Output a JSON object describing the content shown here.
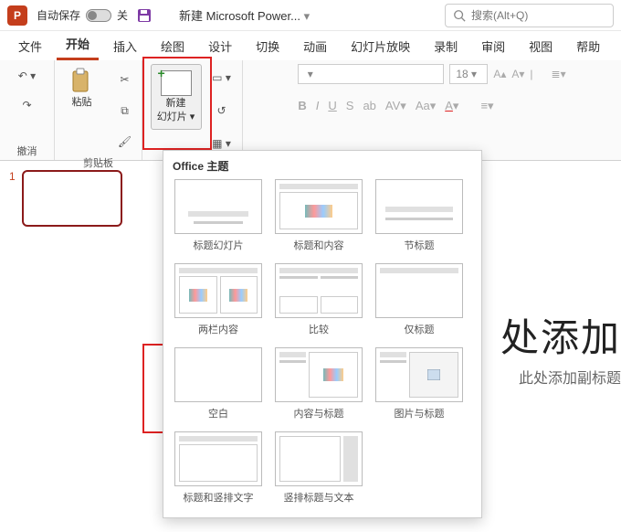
{
  "titlebar": {
    "app_letter": "P",
    "autosave_label": "自动保存",
    "autosave_off": "关",
    "doc_title": "新建 Microsoft Power...",
    "search_placeholder": "搜索(Alt+Q)"
  },
  "tabs": [
    "文件",
    "开始",
    "插入",
    "绘图",
    "设计",
    "切换",
    "动画",
    "幻灯片放映",
    "录制",
    "审阅",
    "视图",
    "帮助"
  ],
  "active_tab_index": 1,
  "ribbon": {
    "undo_group": "撤消",
    "clipboard_group": "剪贴板",
    "paste": "粘贴",
    "new_slide_line1": "新建",
    "new_slide_line2": "幻灯片",
    "font_size": "18"
  },
  "slide_panel": {
    "num": "1"
  },
  "canvas": {
    "title": "处添加",
    "subtitle": "此处添加副标题"
  },
  "gallery": {
    "header": "Office 主题",
    "layouts": [
      "标题幻灯片",
      "标题和内容",
      "节标题",
      "两栏内容",
      "比较",
      "仅标题",
      "空白",
      "内容与标题",
      "图片与标题",
      "标题和竖排文字",
      "竖排标题与文本"
    ]
  }
}
